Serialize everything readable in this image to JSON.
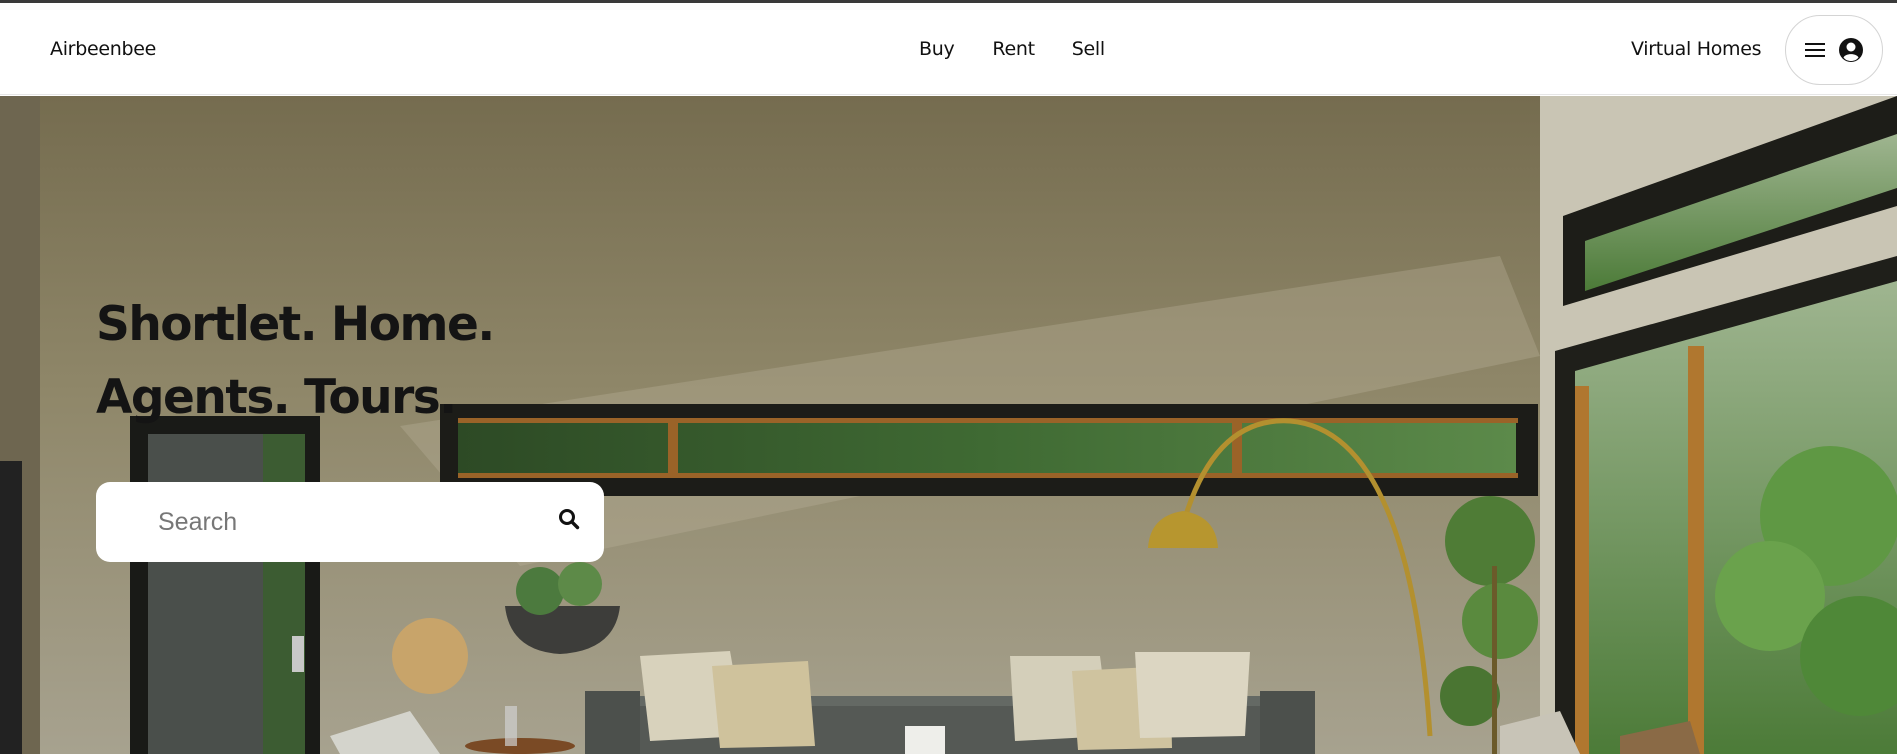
{
  "brand": {
    "name": "Airbeenbee"
  },
  "nav": {
    "items": [
      {
        "label": "Buy"
      },
      {
        "label": "Rent"
      },
      {
        "label": "Sell"
      }
    ],
    "virtual_homes": "Virtual Homes",
    "user_menu_icons": [
      "hamburger-icon",
      "user-circle-icon"
    ]
  },
  "hero": {
    "headline_line1": "Shortlet. Home.",
    "headline_line2": "Agents. Tours.",
    "search": {
      "placeholder": "Search",
      "value": "",
      "icon": "search-icon"
    },
    "background_image": "living-room-photo"
  },
  "colors": {
    "navbar_bg": "#ffffff",
    "text": "#111111",
    "search_bg": "#ffffff"
  }
}
